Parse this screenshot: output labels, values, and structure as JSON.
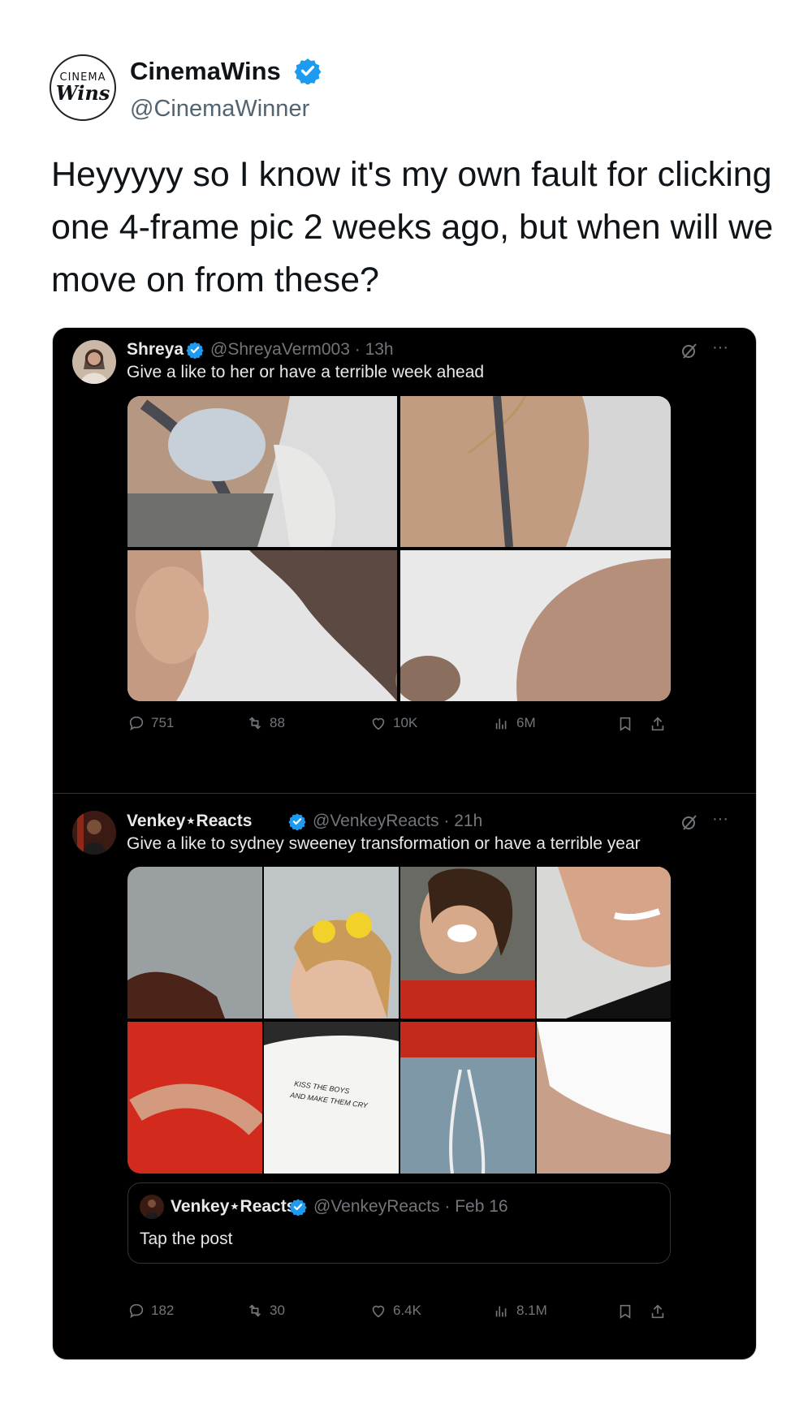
{
  "author": {
    "display_name": "CinemaWins",
    "handle": "@CinemaWinner",
    "avatar_text_top": "CINEMA",
    "avatar_text_bottom": "Wins",
    "verified": true
  },
  "tweet_text": "Heyyyyy so I know it's my own fault for clicking one 4-frame pic 2 weeks ago, but when will we move on from these?",
  "colors": {
    "verified_blue": "#1d9bf0",
    "card_bg": "#000000",
    "muted": "#71767b"
  },
  "embedded": {
    "post1": {
      "name": "Shreya",
      "handle_time": "@ShreyaVerm003 · 13h",
      "text": "Give a like to her or have a terrible week ahead",
      "stats": {
        "replies": "751",
        "reposts": "88",
        "likes": "10K",
        "views": "6M"
      }
    },
    "post2": {
      "name": "Venkey⋆Reacts",
      "handle_time": "@VenkeyReacts · 21h",
      "text": "Give a like to sydney sweeney transformation or have a terrible year",
      "shirt_text_1": "KISS THE BOYS",
      "shirt_text_2": "AND MAKE THEM CRY",
      "quote": {
        "name": "Venkey⋆Reacts",
        "handle_time": "@VenkeyReacts · Feb 16",
        "text": "Tap the post"
      },
      "stats": {
        "replies": "182",
        "reposts": "30",
        "likes": "6.4K",
        "views": "8.1M"
      }
    }
  }
}
